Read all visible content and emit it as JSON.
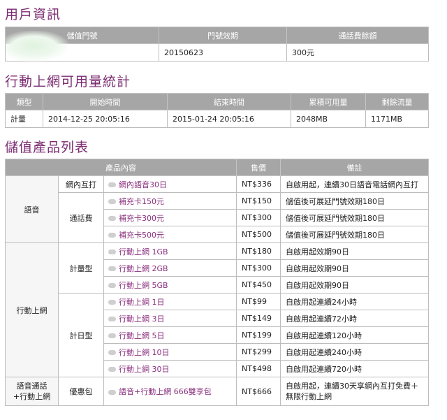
{
  "user_info": {
    "title": "用戶資訊",
    "headers": [
      "儲值門號",
      "門號效期",
      "通話費餘額"
    ],
    "expiry": "20150623",
    "balance": "300元"
  },
  "usage": {
    "title": "行動上網可用量統計",
    "headers": [
      "類型",
      "開始時間",
      "結束時間",
      "累積可用量",
      "剩餘流量"
    ],
    "row": {
      "type": "計量",
      "start": "2014-12-25 20:05:16",
      "end": "2015-01-24 20:05:16",
      "total": "2048MB",
      "remaining": "1171MB"
    }
  },
  "products": {
    "title": "儲值產品列表",
    "headers": [
      "產品內容",
      "售價",
      "備註"
    ],
    "groups": {
      "voice": "語音",
      "data": "行動上網",
      "combo": "語音通話+行動上網"
    },
    "subgroups": {
      "onnet": "網內互打",
      "call_fee": "通話費",
      "metered": "計量型",
      "daily": "計日型",
      "bundle": "優惠包"
    },
    "items": [
      {
        "name": "網內語音30日",
        "price": "NT$336",
        "note": "自啟用起，連續30日語音電話網內互打"
      },
      {
        "name": "補充卡150元",
        "price": "NT$150",
        "note": "儲值後可展延門號效期180日"
      },
      {
        "name": "補充卡300元",
        "price": "NT$300",
        "note": "儲值後可展延門號效期180日"
      },
      {
        "name": "補充卡500元",
        "price": "NT$500",
        "note": "儲值後可展延門號效期180日"
      },
      {
        "name": "行動上網 1GB",
        "price": "NT$180",
        "note": "自啟用起效期90日"
      },
      {
        "name": "行動上網 2GB",
        "price": "NT$300",
        "note": "自啟用起效期90日"
      },
      {
        "name": "行動上網 5GB",
        "price": "NT$450",
        "note": "自啟用起效期90日"
      },
      {
        "name": "行動上網 1日",
        "price": "NT$99",
        "note": "自啟用起連續24小時"
      },
      {
        "name": "行動上網 3日",
        "price": "NT$149",
        "note": "自啟用起連續72小時"
      },
      {
        "name": "行動上網 5日",
        "price": "NT$199",
        "note": "自啟用起連續120小時"
      },
      {
        "name": "行動上網 10日",
        "price": "NT$299",
        "note": "自啟用起連續240小時"
      },
      {
        "name": "行動上網 30日",
        "price": "NT$498",
        "note": "自啟用起連續720小時"
      },
      {
        "name": "語音+行動上網 666雙享包",
        "price": "NT$666",
        "note": "自啟用起，連續30天享網內互打免費＋無限行動上網"
      }
    ]
  }
}
